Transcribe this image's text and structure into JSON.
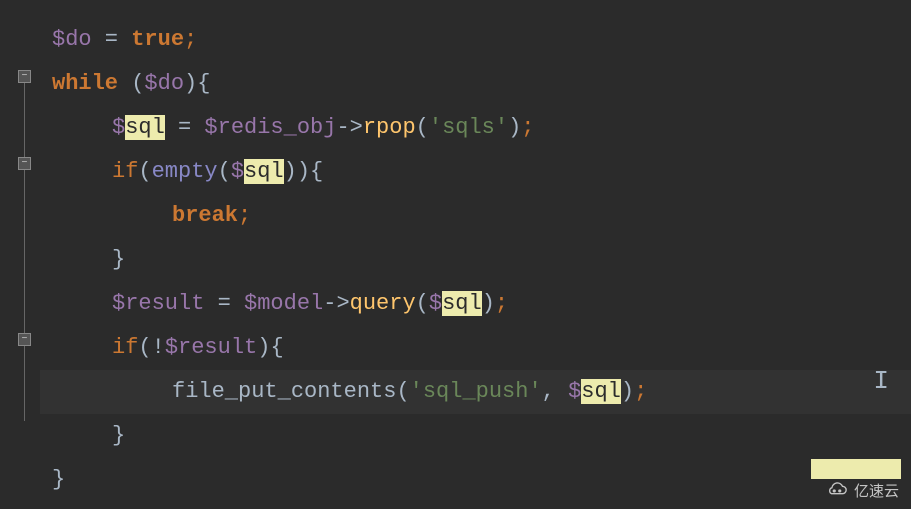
{
  "code": {
    "line1": {
      "var1": "$do",
      "op": " = ",
      "kw": "true",
      "end": ";"
    },
    "line2": {
      "kw": "while",
      "sp": " ",
      "p1": "(",
      "var1": "$do",
      "p2": ")",
      "b": "{"
    },
    "line3": {
      "var1": "$",
      "hl": "sql",
      "op": " = ",
      "var2": "$redis_obj",
      "arrow": "->",
      "method": "rpop",
      "p1": "(",
      "str": "'sqls'",
      "p2": ")",
      "end": ";"
    },
    "line4": {
      "kw": "if",
      "p1": "(",
      "fn": "empty",
      "p2": "(",
      "var1": "$",
      "hl": "sql",
      "p3": ")",
      "p4": ")",
      "b": "{"
    },
    "line5": {
      "kw": "break",
      "end": ";"
    },
    "line6": {
      "b": "}"
    },
    "line7": {
      "var1": "$result",
      "op": " = ",
      "var2": "$model",
      "arrow": "->",
      "method": "query",
      "p1": "(",
      "var3": "$",
      "hl": "sql",
      "p2": ")",
      "end": ";"
    },
    "line8": {
      "kw": "if",
      "p1": "(",
      "bang": "!",
      "var1": "$result",
      "p2": ")",
      "b": "{"
    },
    "line9": {
      "fn": "file_put_contents",
      "p1": "(",
      "str": "'sql_push'",
      "comma": ", ",
      "var1": "$",
      "hl": "sql",
      "p2": ")",
      "end": ";"
    },
    "line10": {
      "b": "}"
    },
    "line11": {
      "b": "}"
    }
  },
  "watermark": {
    "text": "亿速云"
  }
}
